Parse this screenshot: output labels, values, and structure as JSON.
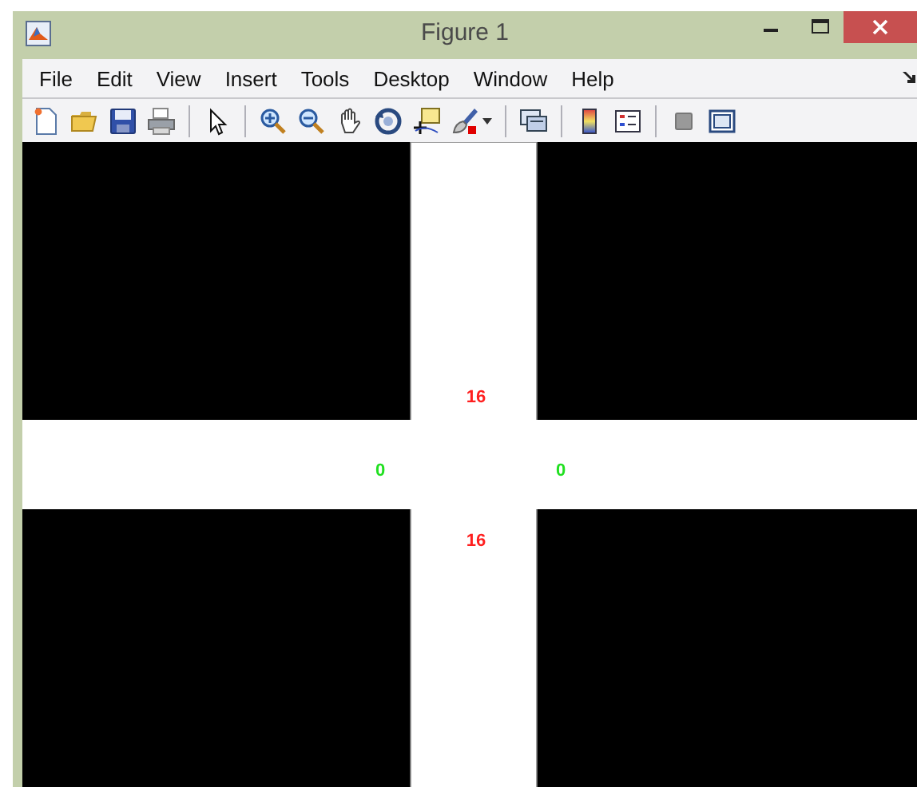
{
  "window": {
    "title": "Figure 1"
  },
  "menu": [
    "File",
    "Edit",
    "View",
    "Insert",
    "Tools",
    "Desktop",
    "Window",
    "Help"
  ],
  "figure": {
    "labels": [
      {
        "text": "16",
        "color": "#ff2020",
        "kind": "top"
      },
      {
        "text": "0",
        "color": "#20e020",
        "kind": "left"
      },
      {
        "text": "0",
        "color": "#20e020",
        "kind": "right"
      },
      {
        "text": "16",
        "color": "#ff2020",
        "kind": "bottom"
      }
    ]
  }
}
